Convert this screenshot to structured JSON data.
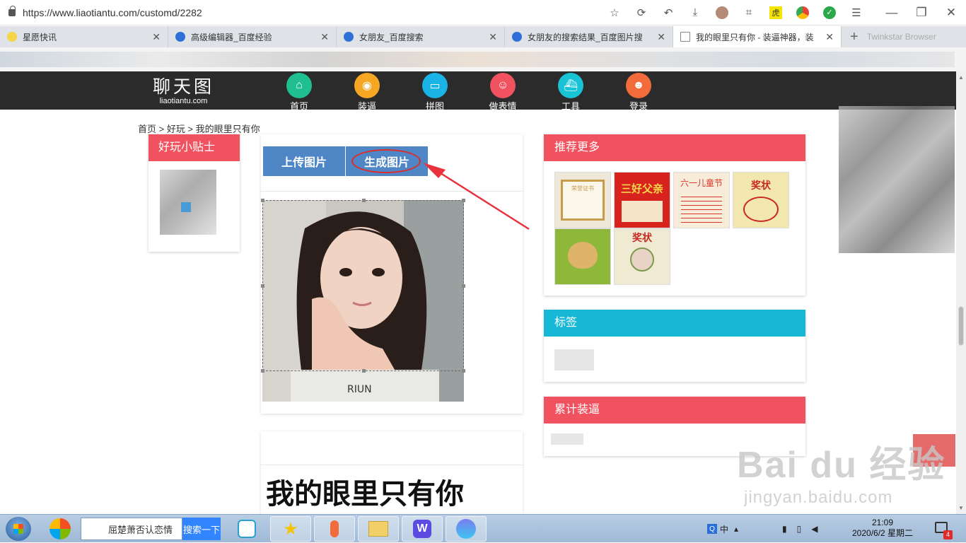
{
  "browser": {
    "url": "https://www.liaotiantu.com/customd/2282",
    "tabs": [
      {
        "label": "星愿快讯",
        "active": false,
        "icon": "smiley-icon"
      },
      {
        "label": "高级编辑器_百度经验",
        "active": false,
        "icon": "baidu-paw-icon"
      },
      {
        "label": "女朋友_百度搜索",
        "active": false,
        "icon": "baidu-paw-icon"
      },
      {
        "label": "女朋友的搜索结果_百度图片搜",
        "active": false,
        "icon": "baidu-paw-icon"
      },
      {
        "label": "我的眼里只有你 - 装逼神器，装",
        "active": true,
        "icon": "page-icon"
      }
    ],
    "newtab_label": "Twinkstar Browser",
    "toolbar_icons": [
      "star-icon",
      "refresh-icon",
      "undo-icon",
      "download-icon",
      "avatar-icon",
      "crop-icon",
      "tiger-icon",
      "chrome-icon",
      "check-icon",
      "menu-icon"
    ],
    "window_controls": [
      "minimize-icon",
      "restore-icon",
      "close-icon"
    ]
  },
  "site": {
    "logo_text": "聊天图",
    "logo_sub": "liaotiantu.com",
    "nav": [
      {
        "label": "首页",
        "color": "#1fbf8f",
        "icon": "home-icon"
      },
      {
        "label": "装逼",
        "color": "#f5a623",
        "icon": "camera-icon"
      },
      {
        "label": "拼图",
        "color": "#19b3e6",
        "icon": "car-icon"
      },
      {
        "label": "做表情",
        "color": "#f0535f",
        "icon": "face-icon"
      },
      {
        "label": "工具",
        "color": "#19c3d6",
        "icon": "ship-icon"
      },
      {
        "label": "登录",
        "color": "#f26b3a",
        "icon": "user-icon"
      }
    ]
  },
  "breadcrumb": "首页 > 好玩 > 我的眼里只有你",
  "tips": {
    "title": "好玩小贴士"
  },
  "editor": {
    "upload_label": "上传图片",
    "generate_label": "生成图片"
  },
  "title_card": {
    "title": "我的眼里只有你"
  },
  "panels": {
    "recommend": {
      "title": "推荐更多",
      "color": "#f0535f",
      "thumbs": [
        {
          "text": "荣誉证书",
          "bg": "#efe8d8",
          "accent": "#c79c4a"
        },
        {
          "text": "三好父亲",
          "bg": "#d8221d",
          "accent": "#f7d84a"
        },
        {
          "text": "六一儿童节",
          "bg": "#f6ecd9",
          "accent": "#d9352b"
        },
        {
          "text": "奖状",
          "bg": "#f3e7b0",
          "accent": "#c82a1f"
        },
        {
          "text": "",
          "bg": "#8db83a",
          "accent": "#e0b36a"
        },
        {
          "text": "奖状",
          "bg": "#f1ead2",
          "accent": "#c22b22"
        }
      ]
    },
    "tags": {
      "title": "标签",
      "color": "#16b8d6"
    },
    "total": {
      "title": "累计装逼",
      "color": "#f0535f"
    }
  },
  "watermark": {
    "brand": "Bai du 经验",
    "domain": "jingyan.baidu.com"
  },
  "taskbar": {
    "search_text": "屈楚萧否认恋情",
    "search_button": "搜索一下",
    "time": "21:09",
    "date": "2020/6/2 星期二",
    "ime": "中",
    "notification_count": "4"
  }
}
